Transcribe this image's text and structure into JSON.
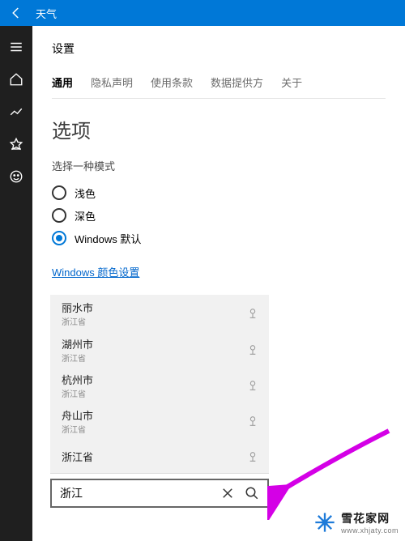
{
  "window": {
    "title": "天气"
  },
  "settings_label": "设置",
  "tabs": [
    "通用",
    "隐私声明",
    "使用条款",
    "数据提供方",
    "关于"
  ],
  "selected_tab": 0,
  "section_title": "选项",
  "mode_label": "选择一种模式",
  "modes": [
    "浅色",
    "深色",
    "Windows 默认"
  ],
  "selected_mode": 2,
  "color_settings_link": "Windows 颜色设置",
  "suggestions": [
    {
      "name": "丽水市",
      "sub": "浙江省"
    },
    {
      "name": "湖州市",
      "sub": "浙江省"
    },
    {
      "name": "杭州市",
      "sub": "浙江省"
    },
    {
      "name": "舟山市",
      "sub": "浙江省"
    },
    {
      "name": "浙江省",
      "sub": ""
    }
  ],
  "search_value": "浙江",
  "watermark": {
    "brand": "雪花家网",
    "url": "www.xhjaty.com"
  },
  "colors": {
    "brand_blue": "#0078d7",
    "sidebar_bg": "#1f1f1f",
    "arrow": "#d400e6"
  }
}
